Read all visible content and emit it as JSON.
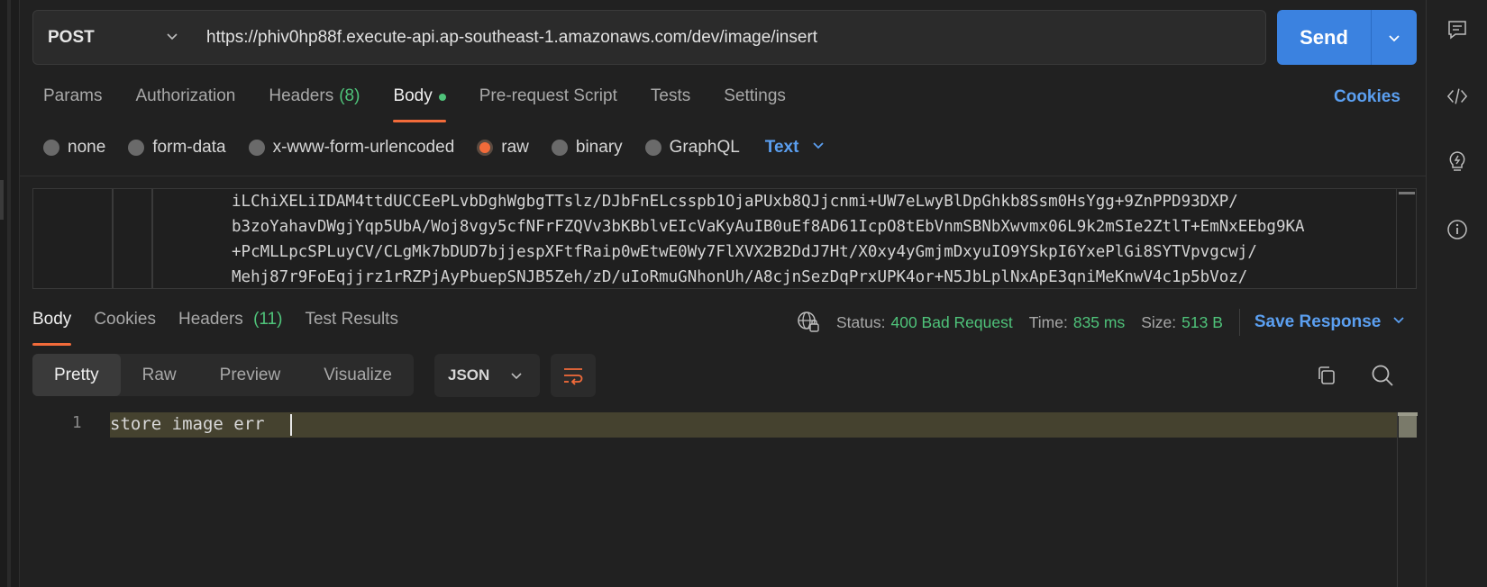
{
  "request": {
    "method": "POST",
    "url": "https://phiv0hp88f.execute-api.ap-southeast-1.amazonaws.com/dev/image/insert",
    "send_label": "Send"
  },
  "req_tabs": {
    "params": "Params",
    "authorization": "Authorization",
    "headers": "Headers",
    "headers_count": "(8)",
    "body": "Body",
    "prerequest": "Pre-request Script",
    "tests": "Tests",
    "settings": "Settings",
    "cookies": "Cookies"
  },
  "body_types": {
    "none": "none",
    "form_data": "form-data",
    "urlencoded": "x-www-form-urlencoded",
    "raw": "raw",
    "binary": "binary",
    "graphql": "GraphQL",
    "raw_format": "Text"
  },
  "editor_lines": [
    "iLChiXELiIDAM4ttdUCCEePLvbDghWgbgTTslz/DJbFnELcsspb1OjaPUxb8QJjcnmi+UW7eLwyBlDpGhkb8Ssm0HsYgg+9ZnPPD93DXP/",
    "b3zoYahavDWgjYqp5UbA/Woj8vgy5cfNFrFZQVv3bKBblvEIcVaKyAuIB0uEf8AD61IcpO8tEbVnmSBNbXwvmx06L9k2mSIe2ZtlT+EmNxEEbg9KA",
    "+PcMLLpcSPLuyCV/CLgMk7bDUD7bjjespXFtfRaip0wEtwE0Wy7FlXVX2B2DdJ7Ht/X0xy4yGmjmDxyuIO9YSkpI6YxePlGi8SYTVpvgcwj/",
    "Mehj87r9FoEqjjrz1rRZPjAyPbuepSNJB5Zeh/zD/uIoRmuGNhonUh/A8cjnSezDqPrxUPK4or+N5JbLplNxApE3qniMeKnwV4c1p5bVoz/"
  ],
  "resp_tabs": {
    "body": "Body",
    "cookies": "Cookies",
    "headers": "Headers",
    "headers_count": "(11)",
    "test_results": "Test Results"
  },
  "response": {
    "status_label": "Status:",
    "status_value": "400 Bad Request",
    "time_label": "Time:",
    "time_value": "835 ms",
    "size_label": "Size:",
    "size_value": "513 B",
    "save_label": "Save Response"
  },
  "view_modes": {
    "pretty": "Pretty",
    "raw": "Raw",
    "preview": "Preview",
    "visualize": "Visualize",
    "format": "JSON"
  },
  "response_body": {
    "line_number": "1",
    "text": "store image err"
  },
  "colors": {
    "accent": "#f26b3a",
    "send_blue": "#3b82e0",
    "link_blue": "#5b9ff0",
    "status_green": "#4fc37a"
  }
}
